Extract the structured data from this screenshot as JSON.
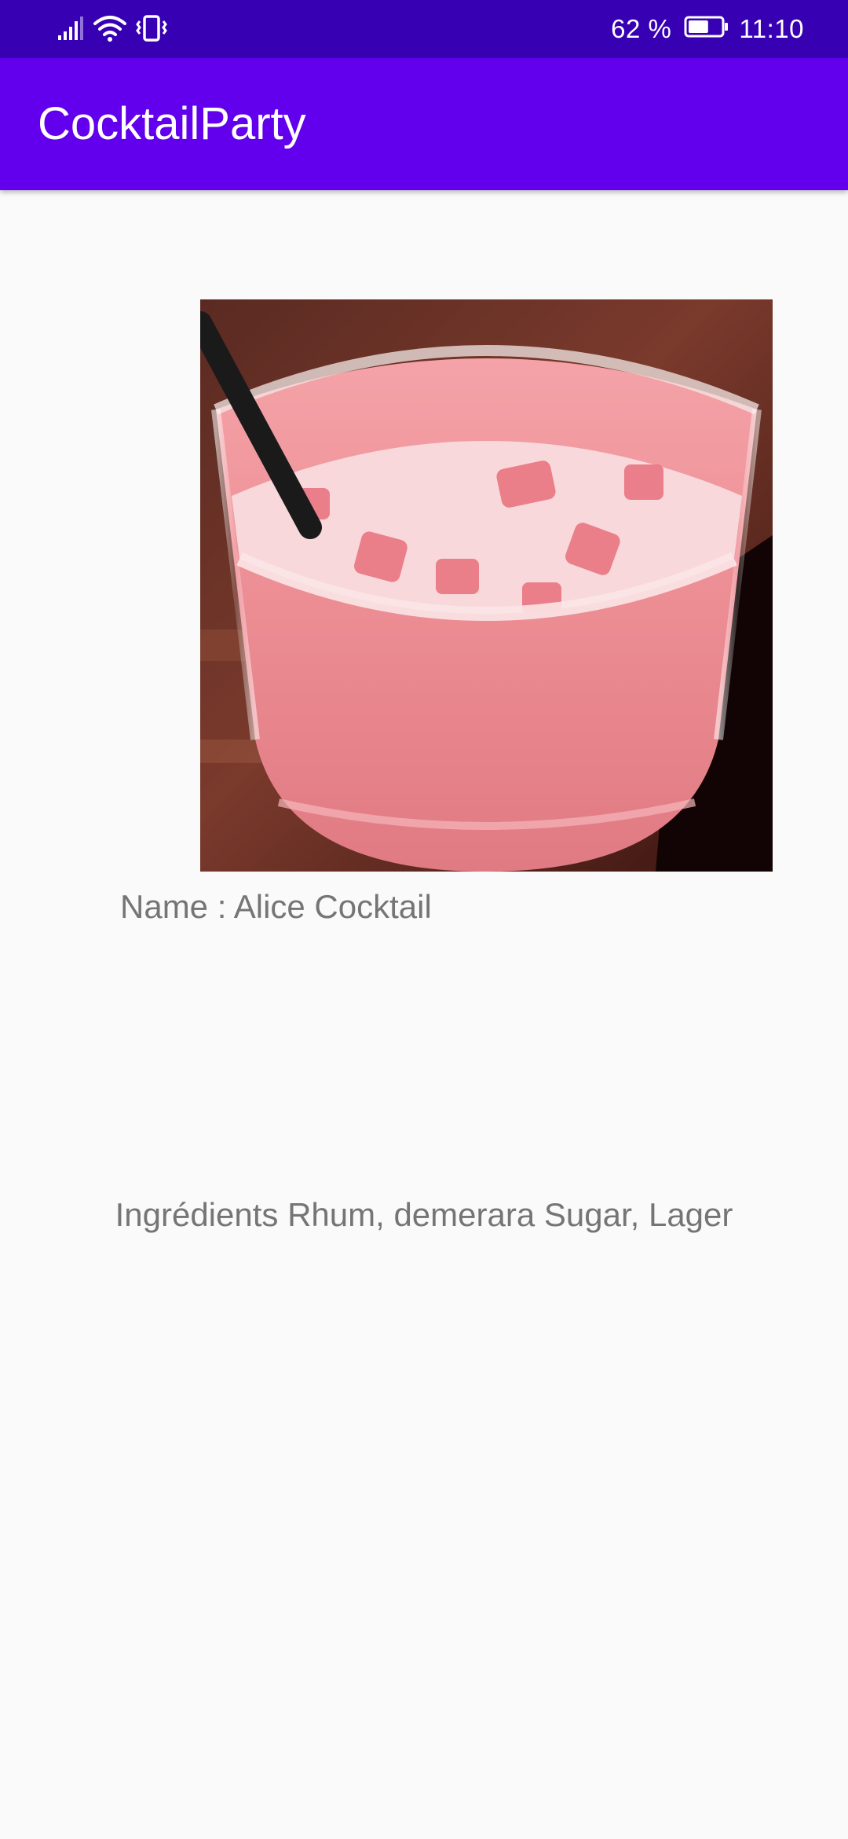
{
  "status_bar": {
    "battery_percent": "62 %",
    "time": "11:10",
    "battery_level": 0.62,
    "icons": [
      "signal-icon",
      "wifi-icon",
      "vibrate-icon",
      "battery-icon"
    ]
  },
  "app_bar": {
    "title": "CocktailParty"
  },
  "detail": {
    "image_icon": "cocktail-photo",
    "name": "Name : Alice Cocktail",
    "ingredients": "Ingrédients Rhum, demerara Sugar, Lager"
  },
  "colors": {
    "status_bar": "#3700b3",
    "app_bar": "#6200ee",
    "background": "#fafafa",
    "text": "#757575"
  }
}
